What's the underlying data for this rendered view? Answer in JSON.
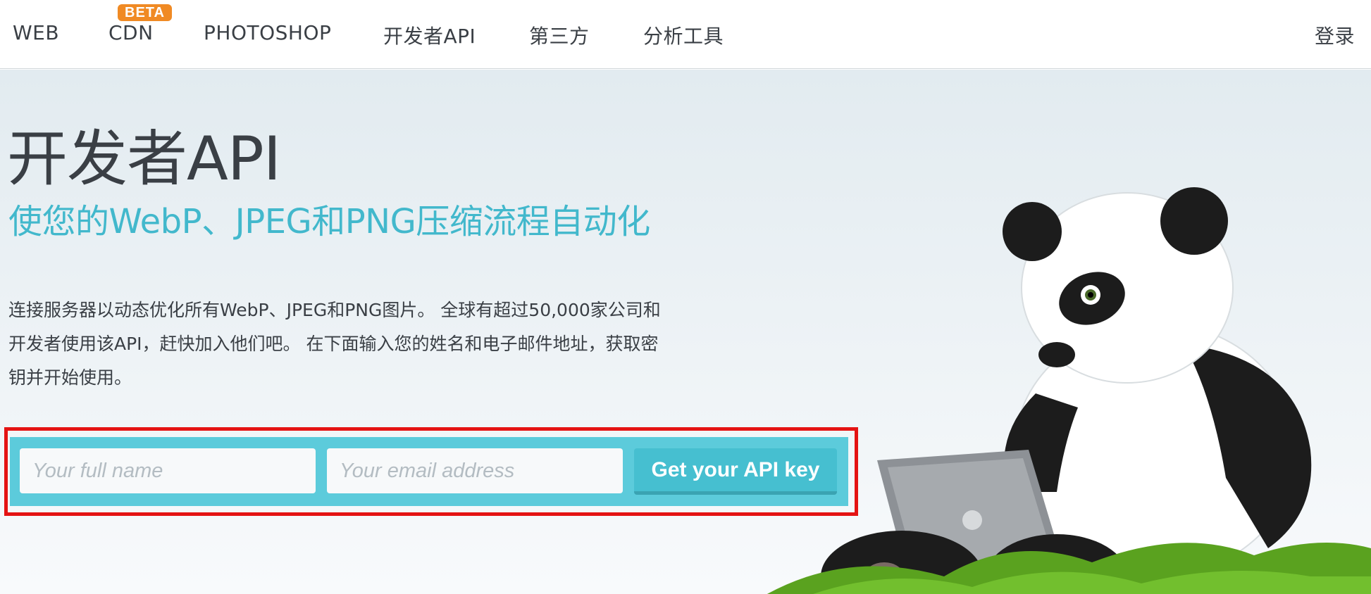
{
  "nav": {
    "items": [
      {
        "label": "WEB"
      },
      {
        "label": "CDN",
        "badge": "BETA"
      },
      {
        "label": "PHOTOSHOP"
      },
      {
        "label": "开发者API"
      },
      {
        "label": "第三方"
      },
      {
        "label": "分析工具"
      }
    ],
    "login": "登录"
  },
  "hero": {
    "title": "开发者API",
    "subtitle": "使您的WebP、JPEG和PNG压缩流程自动化",
    "description_lines": [
      "连接服务器以动态优化所有WebP、JPEG和PNG图片。 全球有超过50,000家公司和",
      "开发者使用该API，赶快加入他们吧。 在下面输入您的姓名和电子邮件地址，获取密",
      "钥并开始使用。"
    ]
  },
  "form": {
    "name_placeholder": "Your full name",
    "email_placeholder": "Your email address",
    "submit_label": "Get your API key"
  },
  "colors": {
    "accent": "#42b8cc",
    "form_bar": "#5ccbdb",
    "button": "#46bfd0",
    "badge": "#f08a24",
    "highlight": "#e41313"
  },
  "illustration": {
    "icon": "panda-with-laptop-icon"
  }
}
